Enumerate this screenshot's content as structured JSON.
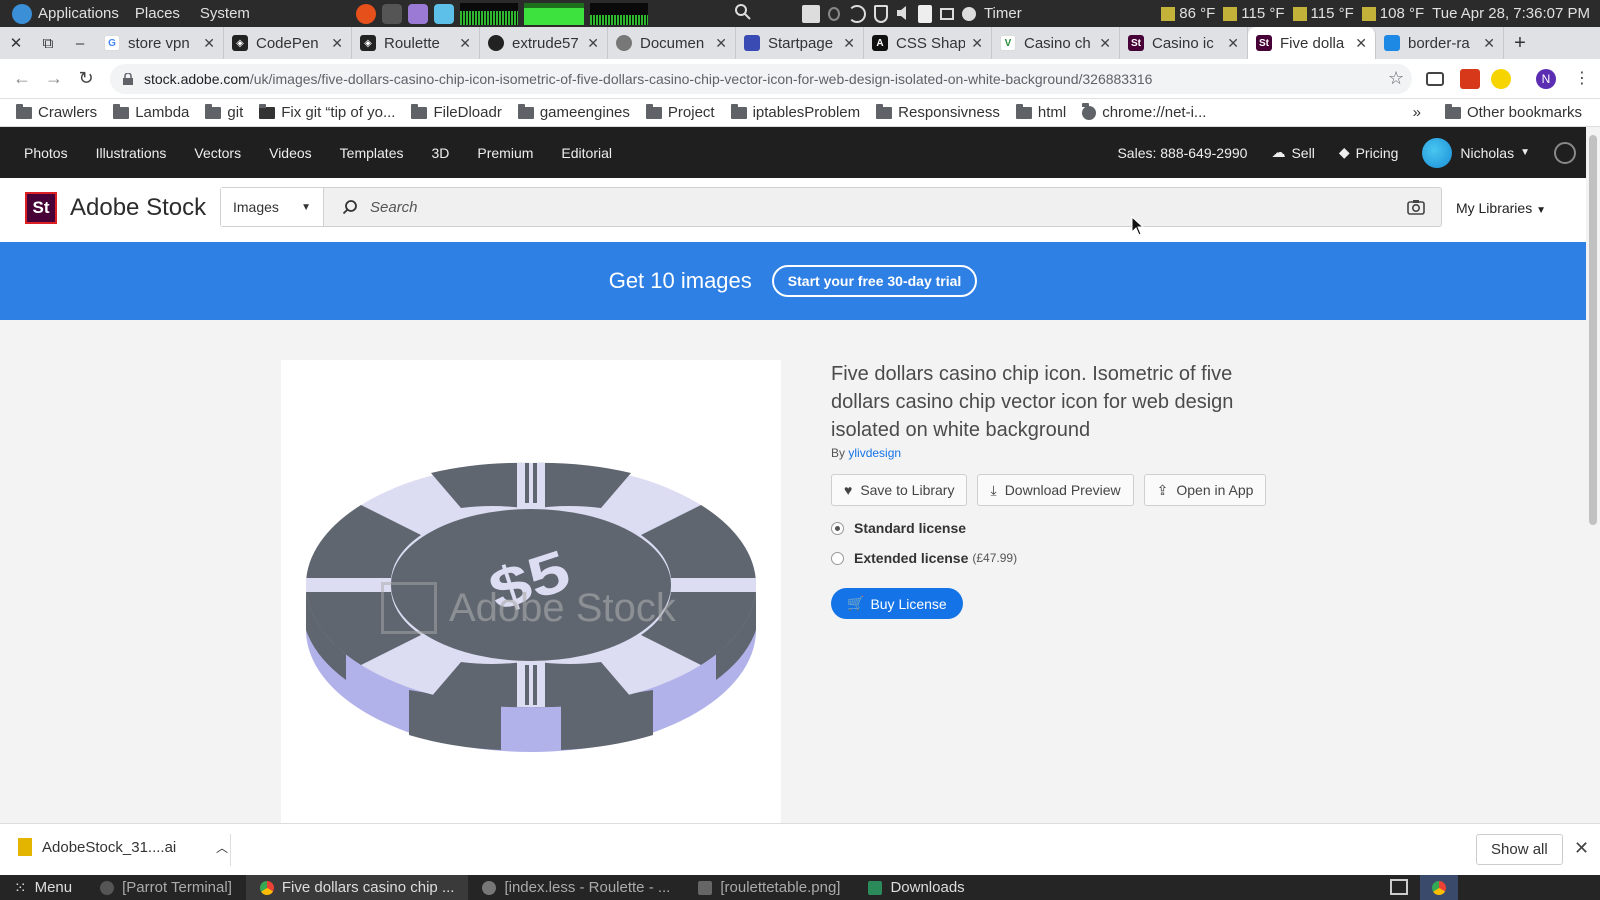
{
  "system_bar": {
    "applications": "Applications",
    "places": "Places",
    "system": "System",
    "timer": "Timer",
    "temps": [
      "86 °F",
      "115 °F",
      "115 °F",
      "108 °F"
    ],
    "clock": "Tue Apr 28, 7:36:07 PM"
  },
  "tabs": [
    {
      "label": "store vpn",
      "favicon": "google-icon"
    },
    {
      "label": "CodePen",
      "favicon": "codepen-icon"
    },
    {
      "label": "Roulette",
      "favicon": "codepen-icon"
    },
    {
      "label": "extrude57",
      "favicon": "github-icon"
    },
    {
      "label": "Documen",
      "favicon": "globe-icon"
    },
    {
      "label": "Startpage",
      "favicon": "startpage-icon"
    },
    {
      "label": "CSS Shap",
      "favicon": "css-icon"
    },
    {
      "label": "Casino ch",
      "favicon": "vector-icon"
    },
    {
      "label": "Casino ic",
      "favicon": "adobe-stock-icon"
    },
    {
      "label": "Five dolla",
      "favicon": "adobe-stock-icon",
      "active": true
    },
    {
      "label": "border-ra",
      "favicon": "mdn-icon"
    }
  ],
  "address": {
    "host": "stock.adobe.com",
    "path": "/uk/images/five-dollars-casino-chip-icon-isometric-of-five-dollars-casino-chip-vector-icon-for-web-design-isolated-on-white-background/326883316"
  },
  "bookmarks": {
    "items": [
      "Crawlers",
      "Lambda",
      "git",
      "Fix git “tip of yo...",
      "FileDloadr",
      "gameengines",
      "Project",
      "iptablesProblem",
      "Responsivness",
      "html",
      "chrome://net-i..."
    ],
    "overflow": "»",
    "other": "Other bookmarks"
  },
  "site_nav": {
    "links": [
      "Photos",
      "Illustrations",
      "Vectors",
      "Videos",
      "Templates",
      "3D",
      "Premium",
      "Editorial"
    ],
    "sales": "Sales: 888-649-2990",
    "sell": "Sell",
    "pricing": "Pricing",
    "user": "Nicholas"
  },
  "search": {
    "brand": "Adobe Stock",
    "logo": "St",
    "type": "Images",
    "placeholder": "Search",
    "my_libraries": "My Libraries"
  },
  "promo": {
    "headline": "Get 10 images",
    "cta": "Start your free 30-day trial"
  },
  "asset": {
    "title": "Five dollars casino chip icon. Isometric of five dollars casino chip vector icon for web design isolated on white background",
    "by_prefix": "By",
    "author": "ylivdesign",
    "watermark": "Adobe Stock",
    "actions": [
      "Save to Library",
      "Download Preview",
      "Open in App"
    ],
    "licenses": [
      {
        "name": "Standard license",
        "price": "",
        "selected": true
      },
      {
        "name": "Extended license",
        "price": "(£47.99)",
        "selected": false
      }
    ],
    "buy": "Buy License"
  },
  "downloads": {
    "file": "AdobeStock_31....ai",
    "show_all": "Show all"
  },
  "taskbar": {
    "menu": "Menu",
    "tasks": [
      "[Parrot Terminal]",
      "Five dollars casino chip ...",
      "[index.less - Roulette - ...",
      "[roulettetable.png]",
      "Downloads"
    ]
  },
  "colors": {
    "promo_blue": "#2f80e4",
    "button_blue": "#1473e6",
    "chip_dark": "#5f6670",
    "chip_light": "#dcdcf2",
    "chip_edge": "#b2b2ea"
  }
}
